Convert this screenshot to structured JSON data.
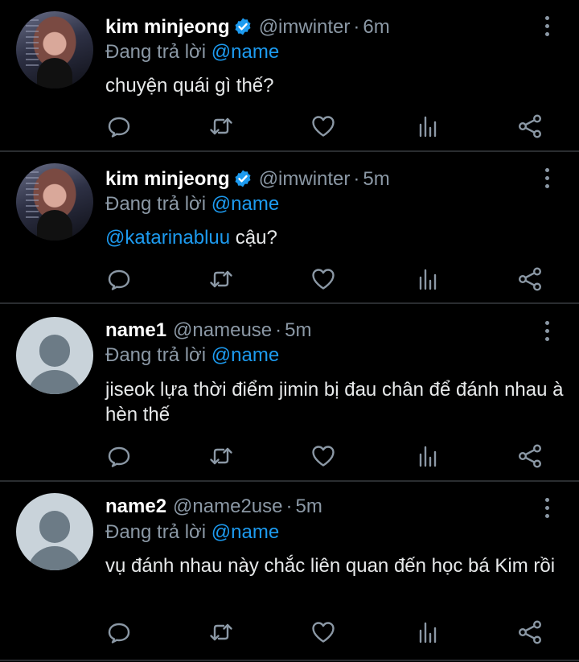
{
  "tweets": [
    {
      "name": "kim minjeong",
      "verified": true,
      "handle": "@imwinter",
      "time": "6m",
      "replying_prefix": "Đang trả lời",
      "replying_to": "@name",
      "text_mention": "",
      "text": "chuyện quái gì thế?",
      "avatar": "profile-photo"
    },
    {
      "name": "kim minjeong",
      "verified": true,
      "handle": "@imwinter",
      "time": "5m",
      "replying_prefix": "Đang trả lời",
      "replying_to": "@name",
      "text_mention": "@katarinabluu",
      "text": " cậu?",
      "avatar": "profile-photo"
    },
    {
      "name": "name1",
      "verified": false,
      "handle": "@nameuse",
      "time": "5m",
      "replying_prefix": "Đang trả lời",
      "replying_to": "@name",
      "text_mention": "",
      "text": "jiseok lựa thời điểm jimin bị đau chân để đánh nhau à hèn thế",
      "avatar": "default-avatar"
    },
    {
      "name": "name2",
      "verified": false,
      "handle": "@name2use",
      "time": "5m",
      "replying_prefix": "Đang trả lời",
      "replying_to": "@name",
      "text_mention": "",
      "text": "vụ đánh nhau này chắc liên quan đến học bá Kim rồi",
      "avatar": "default-avatar"
    }
  ],
  "separator": "·",
  "icons": {
    "reply": "reply-icon",
    "retweet": "retweet-icon",
    "like": "like-icon",
    "views": "views-icon",
    "share": "share-icon",
    "more": "more-options-icon",
    "verified": "verified-badge-icon"
  },
  "colors": {
    "background": "#000000",
    "text": "#e7e9ea",
    "secondary": "#8b98a5",
    "accent": "#1d9bf0",
    "divider": "#2a2d30"
  }
}
